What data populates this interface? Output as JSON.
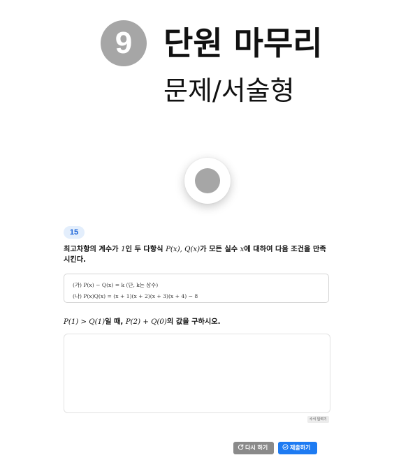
{
  "header": {
    "unit_number": "9",
    "title": "단원 마무리",
    "subtitle": "문제/서술형"
  },
  "recorder": {
    "icon": "record-icon"
  },
  "problem": {
    "number": "15",
    "stem_part1": "최고차항의 계수가 ",
    "stem_math1": "1",
    "stem_part2": "인 두 다항식 ",
    "stem_math2": "P(x), Q(x)",
    "stem_part3": "가 모든 실수 ",
    "stem_math3": "x",
    "stem_part4": "에 대하여 다음 조건을 만족시킨다.",
    "conditions": [
      {
        "label": "(가)",
        "text": "P(x) − Q(x) = k (단, k는 상수)"
      },
      {
        "label": "(나)",
        "text": "P(x)Q(x) = (x + 1)(x + 2)(x + 3)(x + 4) − 8"
      }
    ],
    "ask_math1": "P(1) > Q(1)",
    "ask_part1": "일 때, ",
    "ask_math2": "P(2) + Q(0)",
    "ask_part2": "의 값을 구하시오."
  },
  "answer": {
    "value": "",
    "formula_button": "수식 입력기"
  },
  "actions": {
    "retry_label": "다시 하기",
    "submit_label": "제출하기",
    "retry_color": "#8a8a8a",
    "submit_color": "#1e7bf2"
  }
}
